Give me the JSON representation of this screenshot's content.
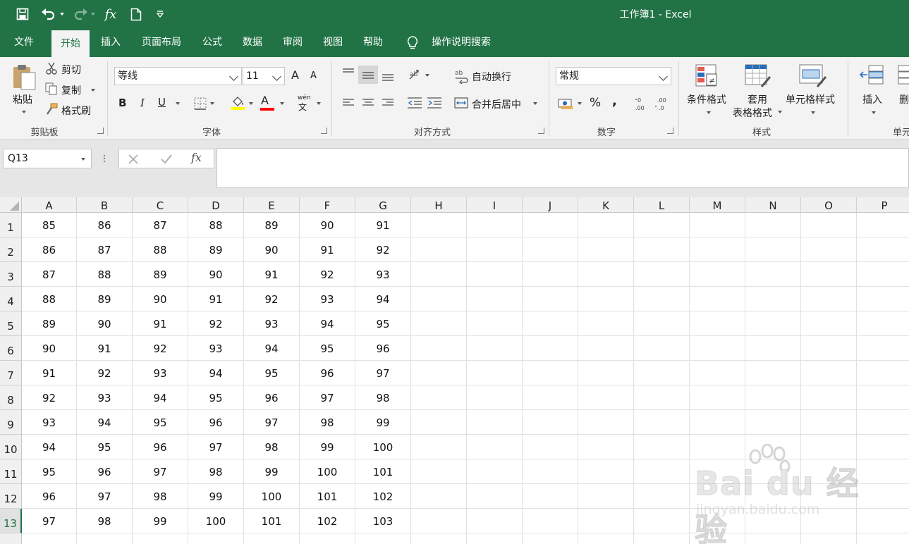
{
  "window": {
    "title": "工作簿1  -  Excel",
    "qat_icons": [
      "save-icon",
      "undo-icon",
      "redo-icon",
      "function-icon",
      "new-file-icon",
      "customize-qat-icon"
    ]
  },
  "tabs": [
    "文件",
    "开始",
    "插入",
    "页面布局",
    "公式",
    "数据",
    "审阅",
    "视图",
    "帮助"
  ],
  "active_tab": "开始",
  "search_label": "操作说明搜索",
  "ribbon": {
    "clipboard": {
      "paste": "粘贴",
      "cut": "剪切",
      "copy": "复制",
      "format_painter": "格式刷",
      "label": "剪贴板"
    },
    "font": {
      "name": "等线",
      "size": "11",
      "bold": "B",
      "italic": "I",
      "underline": "U",
      "label": "字体",
      "phonetic": "wén",
      "phonetic_char": "文",
      "grow_font": "A",
      "shrink_font": "A",
      "font_color_letter": "A"
    },
    "alignment": {
      "wrap_text": "自动换行",
      "merge_center": "合并后居中",
      "label": "对齐方式"
    },
    "number": {
      "format": "常规",
      "percent": "%",
      "comma": ",",
      "label": "数字"
    },
    "styles": {
      "conditional": "条件格式",
      "table_format_line1": "套用",
      "table_format_line2": "表格格式",
      "cell_styles": "单元格样式",
      "label": "样式"
    },
    "cells": {
      "insert": "插入",
      "delete": "删",
      "label": "单元"
    }
  },
  "formula_bar": {
    "name_box": "Q13",
    "fx": "fx",
    "content": ""
  },
  "columns": [
    "A",
    "B",
    "C",
    "D",
    "E",
    "F",
    "G",
    "H",
    "I",
    "J",
    "K",
    "L",
    "M",
    "N",
    "O",
    "P"
  ],
  "rows": [
    [
      "85",
      "86",
      "87",
      "88",
      "89",
      "90",
      "91"
    ],
    [
      "86",
      "87",
      "88",
      "89",
      "90",
      "91",
      "92"
    ],
    [
      "87",
      "88",
      "89",
      "90",
      "91",
      "92",
      "93"
    ],
    [
      "88",
      "89",
      "90",
      "91",
      "92",
      "93",
      "94"
    ],
    [
      "89",
      "90",
      "91",
      "92",
      "93",
      "94",
      "95"
    ],
    [
      "90",
      "91",
      "92",
      "93",
      "94",
      "95",
      "96"
    ],
    [
      "91",
      "92",
      "93",
      "94",
      "95",
      "96",
      "97"
    ],
    [
      "92",
      "93",
      "94",
      "95",
      "96",
      "97",
      "98"
    ],
    [
      "93",
      "94",
      "95",
      "96",
      "97",
      "98",
      "99"
    ],
    [
      "94",
      "95",
      "96",
      "97",
      "98",
      "99",
      "100"
    ],
    [
      "95",
      "96",
      "97",
      "98",
      "99",
      "100",
      "101"
    ],
    [
      "96",
      "97",
      "98",
      "99",
      "100",
      "101",
      "102"
    ],
    [
      "97",
      "98",
      "99",
      "100",
      "101",
      "102",
      "103"
    ]
  ],
  "selected_row": 13,
  "watermark": {
    "brand": "Bai du 经验",
    "url": "jingyan.baidu.com"
  },
  "colors": {
    "excel_green": "#217346",
    "font_color": "#ff0000",
    "highlight": "#ffff00"
  }
}
